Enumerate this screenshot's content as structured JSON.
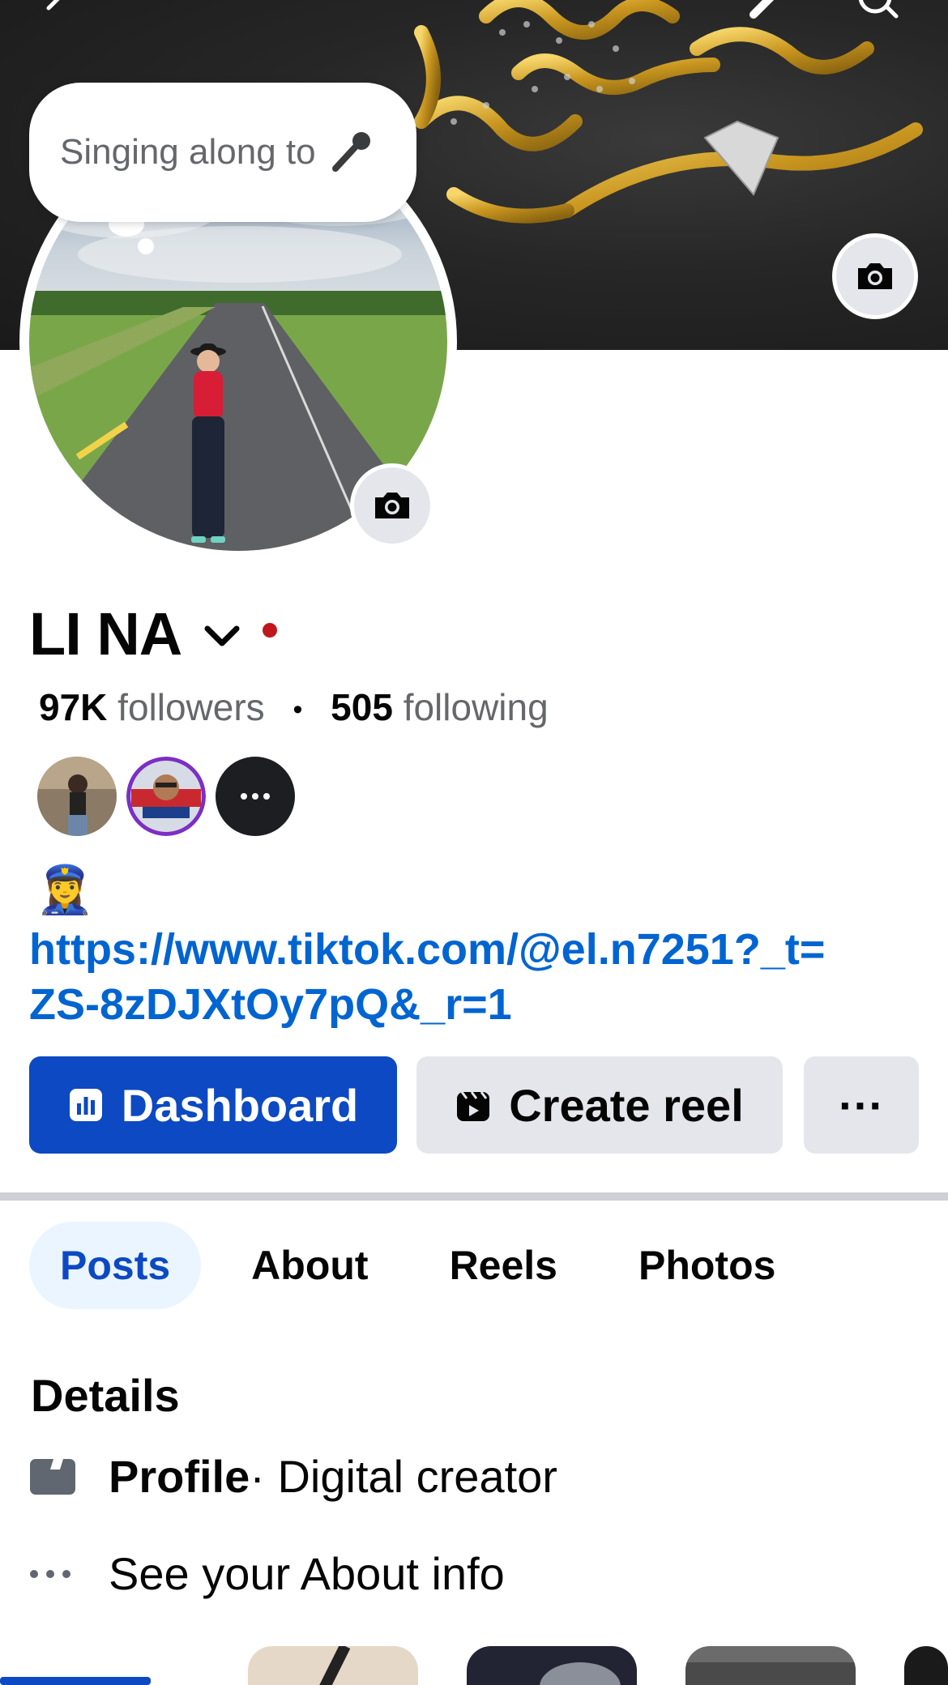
{
  "cover": {
    "back_icon": "chevron-left-icon",
    "edit_icon": "pencil-icon",
    "search_icon": "search-icon",
    "camera_icon": "camera-icon"
  },
  "status_bubble": {
    "text": "Singing along to",
    "icon": "microphone-icon"
  },
  "profile": {
    "name": "LI NA",
    "followers_count": "97K",
    "followers_label": "followers",
    "separator": "•",
    "following_count": "505",
    "following_label": "following",
    "bio_emoji": "👮‍♀️",
    "bio_link": "https://www.tiktok.com/@el.n7251?_t=ZS-8zDJXtOy7pQ&_r=1",
    "status_dot_color": "#c0161d"
  },
  "buttons": {
    "dashboard": "Dashboard",
    "create_reel": "Create reel",
    "more": "···"
  },
  "tabs": [
    {
      "label": "Posts",
      "active": true
    },
    {
      "label": "About",
      "active": false
    },
    {
      "label": "Reels",
      "active": false
    },
    {
      "label": "Photos",
      "active": false
    }
  ],
  "details": {
    "title": "Details",
    "profile_label": "Profile",
    "profile_value": " · Digital creator",
    "about_info": "See your About info"
  },
  "colors": {
    "accent": "#0c49c2",
    "link": "#0064d1",
    "secondary_text": "#65676b",
    "button_gray": "#e4e6eb"
  }
}
